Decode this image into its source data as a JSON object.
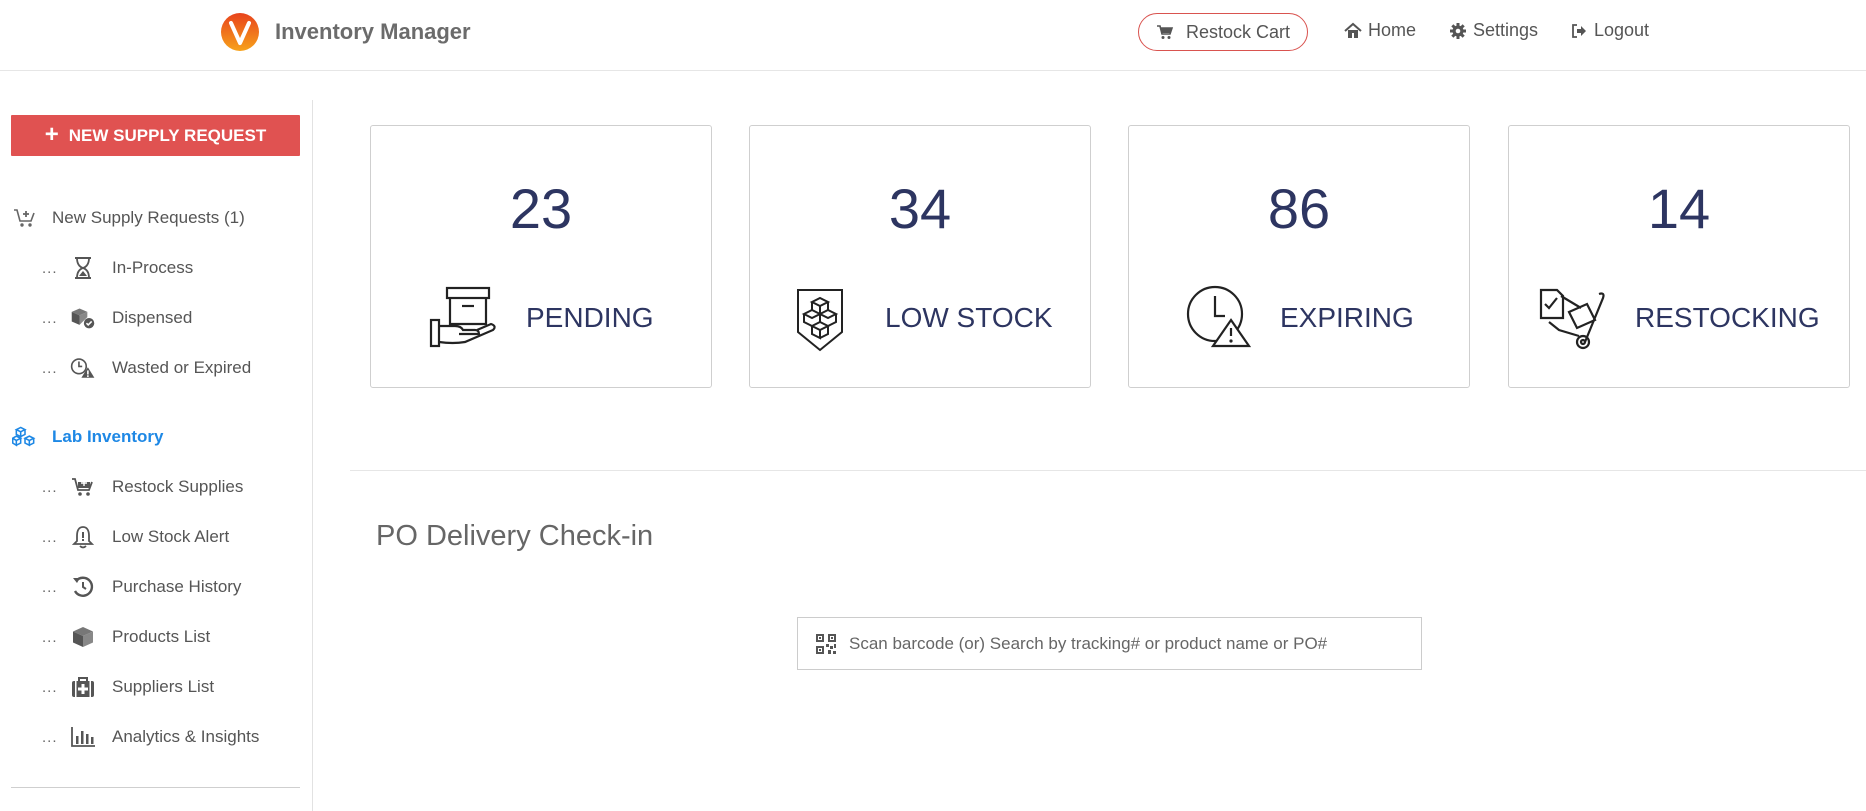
{
  "header": {
    "app_title": "Inventory Manager",
    "restock_cart_label": "Restock Cart",
    "nav": {
      "home": "Home",
      "settings": "Settings",
      "logout": "Logout"
    }
  },
  "sidebar": {
    "new_request_label": "NEW SUPPLY REQUEST",
    "groups": [
      {
        "label": "New Supply Requests (1)",
        "icon": "cart-plus-icon",
        "items": [
          {
            "label": "In-Process",
            "icon": "hourglass-icon"
          },
          {
            "label": "Dispensed",
            "icon": "box-check-icon"
          },
          {
            "label": "Wasted or Expired",
            "icon": "clock-warning-icon"
          }
        ]
      },
      {
        "label": "Lab Inventory",
        "icon": "cubes-icon",
        "items": [
          {
            "label": "Restock Supplies",
            "icon": "cart-plus-icon"
          },
          {
            "label": "Low Stock Alert",
            "icon": "bell-alert-icon"
          },
          {
            "label": "Purchase History",
            "icon": "history-icon"
          },
          {
            "label": "Products List",
            "icon": "box-icon"
          },
          {
            "label": "Suppliers List",
            "icon": "medkit-icon"
          },
          {
            "label": "Analytics & Insights",
            "icon": "bar-chart-icon"
          }
        ]
      }
    ],
    "dots": "..."
  },
  "cards": [
    {
      "count": "23",
      "label": "PENDING",
      "icon": "box-hand-icon"
    },
    {
      "count": "34",
      "label": "LOW STOCK",
      "icon": "cubes-arrow-down-icon"
    },
    {
      "count": "86",
      "label": "EXPIRING",
      "icon": "clock-warning-icon"
    },
    {
      "count": "14",
      "label": "RESTOCKING",
      "icon": "hand-truck-icon"
    }
  ],
  "po_section": {
    "title": "PO Delivery Check-in",
    "search_placeholder": "Scan barcode (or) Search by tracking# or product name or PO#"
  },
  "colors": {
    "accent_red": "#e05251",
    "link_blue": "#1e88e5",
    "card_text": "#2d3561"
  }
}
